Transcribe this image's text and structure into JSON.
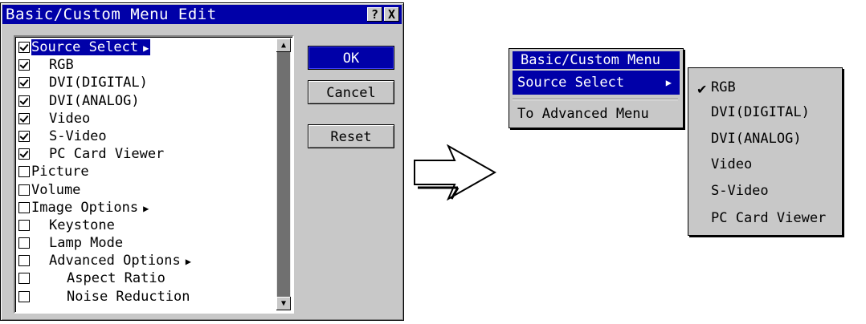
{
  "dialog": {
    "title": "Basic/Custom Menu Edit",
    "help_label": "?",
    "close_label": "X",
    "items": [
      {
        "label": "Source Select",
        "checked": true,
        "indent": 0,
        "submenu": true,
        "selected": true
      },
      {
        "label": "RGB",
        "checked": true,
        "indent": 1
      },
      {
        "label": "DVI(DIGITAL)",
        "checked": true,
        "indent": 1
      },
      {
        "label": "DVI(ANALOG)",
        "checked": true,
        "indent": 1
      },
      {
        "label": "Video",
        "checked": true,
        "indent": 1
      },
      {
        "label": "S-Video",
        "checked": true,
        "indent": 1
      },
      {
        "label": "PC Card Viewer",
        "checked": true,
        "indent": 1
      },
      {
        "label": "Picture",
        "checked": false,
        "indent": 0
      },
      {
        "label": "Volume",
        "checked": false,
        "indent": 0
      },
      {
        "label": "Image Options",
        "checked": false,
        "indent": 0,
        "submenu": true
      },
      {
        "label": "Keystone",
        "checked": false,
        "indent": 1
      },
      {
        "label": "Lamp Mode",
        "checked": false,
        "indent": 1
      },
      {
        "label": "Advanced Options",
        "checked": false,
        "indent": 1,
        "submenu": true
      },
      {
        "label": "Aspect Ratio",
        "checked": false,
        "indent": 2
      },
      {
        "label": "Noise Reduction",
        "checked": false,
        "indent": 2
      }
    ],
    "scroll": {
      "thumb_start": 0.0,
      "thumb_end": 1.0
    },
    "buttons": {
      "ok": "OK",
      "cancel": "Cancel",
      "reset": "Reset"
    }
  },
  "arrow_icon": "right-arrow-icon",
  "menu": {
    "title": "Basic/Custom Menu",
    "source_select": "Source Select",
    "to_advanced": "To Advanced Menu"
  },
  "submenu": {
    "checked_index": 0,
    "items": [
      "RGB",
      "DVI(DIGITAL)",
      "DVI(ANALOG)",
      "Video",
      "S-Video",
      "PC Card Viewer"
    ]
  },
  "colors": {
    "title_bar": "#0000a8",
    "panel": "#c8c8c8"
  }
}
